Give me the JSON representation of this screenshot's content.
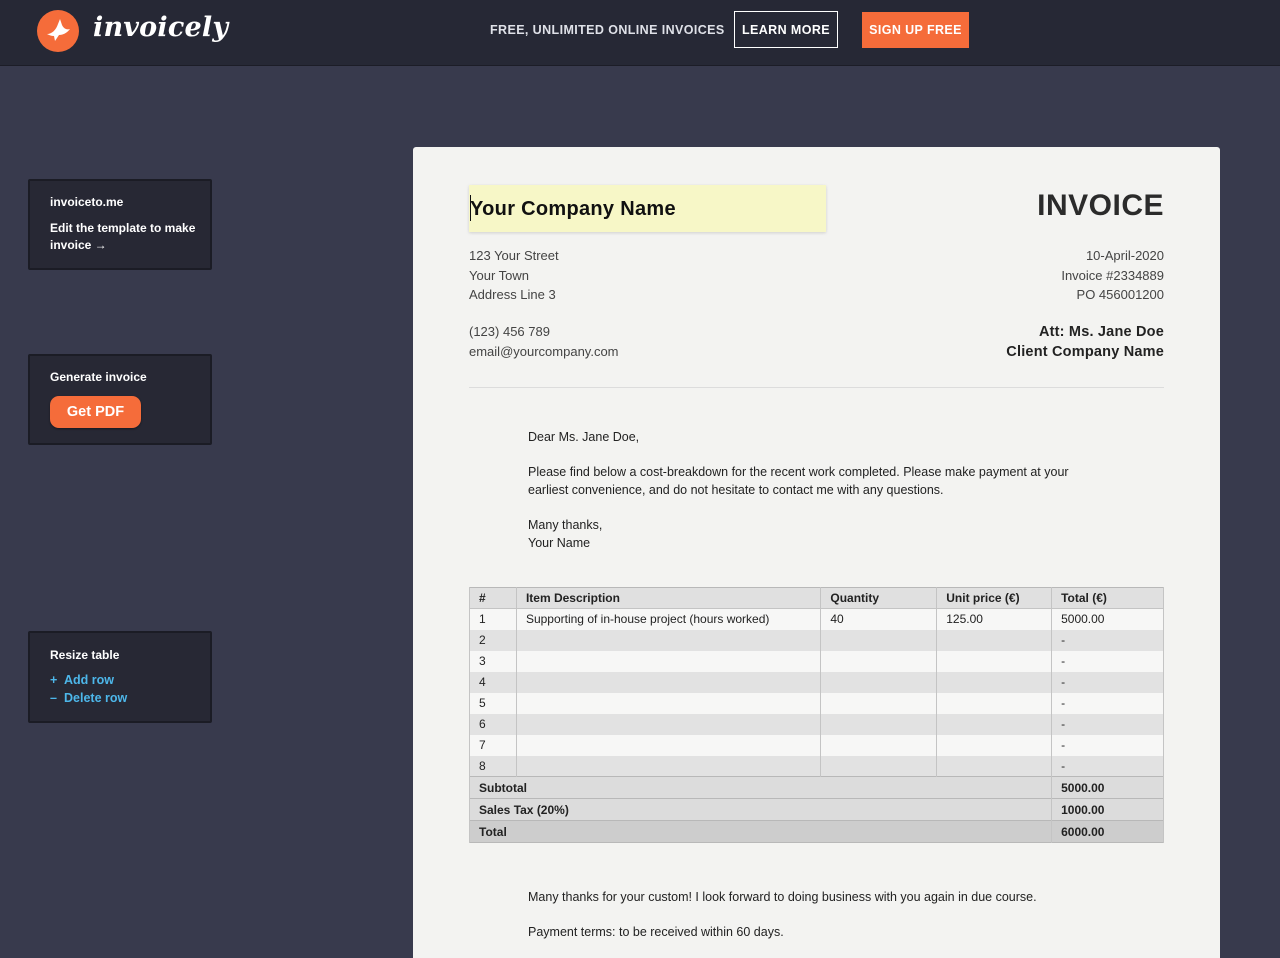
{
  "header": {
    "brand": "invoicely",
    "tagline": "FREE, UNLIMITED ONLINE INVOICES",
    "learn_more": "LEARN MORE",
    "sign_up": "SIGN UP FREE"
  },
  "sidebar": {
    "panel1": {
      "title": "invoiceto.me",
      "text": "Edit the template to make invoice →"
    },
    "panel2": {
      "title": "Generate invoice",
      "button": "Get PDF"
    },
    "panel3": {
      "title": "Resize table",
      "add": "Add row",
      "delete": "Delete row",
      "add_sym": "+",
      "delete_sym": "–"
    }
  },
  "invoice": {
    "company": "Your Company Name",
    "title": "INVOICE",
    "address": [
      "123 Your Street",
      "Your Town",
      "Address Line 3"
    ],
    "phone": "(123) 456 789",
    "email": "email@yourcompany.com",
    "date": "10-April-2020",
    "number": "Invoice #2334889",
    "po": "PO 456001200",
    "att": "Att: Ms. Jane Doe",
    "client": "Client Company Name",
    "greeting": "Dear Ms. Jane Doe,",
    "body": "Please find below a cost-breakdown for the recent work completed. Please make payment at your earliest convenience, and do not hesitate to contact me with any questions.",
    "thanks": "Many thanks,",
    "signature": "Your Name",
    "closing": "Many thanks for your custom! I look forward to doing business with you again in due course.",
    "terms": "Payment terms: to be received within 60 days."
  },
  "table": {
    "headers": [
      "#",
      "Item Description",
      "Quantity",
      "Unit price (€)",
      "Total (€)"
    ],
    "rows": [
      [
        "1",
        "Supporting of in-house project (hours worked)",
        "40",
        "125.00",
        "5000.00"
      ],
      [
        "2",
        "",
        "",
        "",
        "-"
      ],
      [
        "3",
        "",
        "",
        "",
        "-"
      ],
      [
        "4",
        "",
        "",
        "",
        "-"
      ],
      [
        "5",
        "",
        "",
        "",
        "-"
      ],
      [
        "6",
        "",
        "",
        "",
        "-"
      ],
      [
        "7",
        "",
        "",
        "",
        "-"
      ],
      [
        "8",
        "",
        "",
        "",
        "-"
      ]
    ],
    "subtotal_label": "Subtotal",
    "subtotal": "5000.00",
    "tax_label": "Sales Tax (20%)",
    "tax": "1000.00",
    "total_label": "Total",
    "total": "6000.00"
  },
  "colors": {
    "accent": "#f56c3a",
    "link": "#4db7ea",
    "background": "#383a4d",
    "topbar": "#262835"
  }
}
